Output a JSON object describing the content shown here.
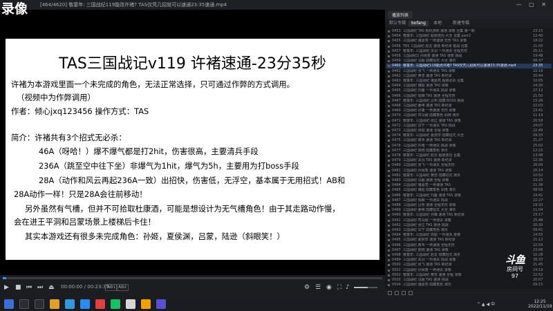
{
  "overlay": {
    "recording_label": "录像"
  },
  "window": {
    "count": "[464/4620]",
    "title": "[464/4620] 敬童年: 三国战纪119能改许褚? TAS仅凭几招就可以速通23:35速通.mp4",
    "controls": "— ▢ ✕"
  },
  "slide": {
    "title": "TAS三国战记v119 许褚速通-23分35秒",
    "lines": [
      "许褚为本游戏里面一个未完成的角色，无法正常选择，只可通过作弊的方式调用。",
      "（视频中为作弊调用）",
      "作者：倾心jxq123456      操作方式：TAS",
      "简介：许褚共有3个招式无必杀：",
      "46A（呀哈！）爆不爆气都是打2hit，伤害很高，主要清兵手段",
      "236A（跳至空中往下坐）非爆气为1hit，爆气为5h，主要用为打boss手段",
      "28A（动作和风云再起236A一致）出招快，伤害低，无浮空，基本属于无用招式！AB和",
      "28A动作一样！只是28A会往前移动！",
      "另外虽然有气槽，但并不可拾取杜康酒，可能是想设计为无气槽角色！由于其走路动作慢，",
      "会在进王平洞和吕蒙场景上楼梯后卡住！",
      "其实本游戏还有很多未完成角色：孙姬，夏侯渊，吕蒙，陆逊（斜眼笑！）"
    ]
  },
  "player": {
    "progress": 0.01,
    "time": "00:00:00 / 00:23:35",
    "tag1": "AB1",
    "tag2": "AB2",
    "volume": 0.6
  },
  "playlist": {
    "title": "播放列表",
    "tabs": [
      "默认专辑",
      "bofang",
      "本地",
      "新建专辑"
    ],
    "active_index": 7,
    "items": [
      {
        "num": "0453",
        "name": "三国战纪 TAS 街机游戏 速通 录像 合集 第一期",
        "dur": "23:15"
      },
      {
        "num": "0454",
        "name": "敬童年: 三国战纪 超级连招 大全 合集 part2",
        "dur": "12:40"
      },
      {
        "num": "0455",
        "name": "三国战纪 诸葛亮 一命速通 无伤 TAS 录像",
        "dur": "18:22"
      },
      {
        "num": "0456",
        "name": "TAS 三国战纪 赵云 速通 新纪录 挑战 合集",
        "dur": "21:05"
      },
      {
        "num": "0457",
        "name": "敬童年: 三国战纪 关羽 一币通关 全程无伤",
        "dur": "25:11"
      },
      {
        "num": "0458",
        "name": "三国战纪2 孙尚香 速通 TAS 录像 挑战",
        "dur": "19:48"
      },
      {
        "num": "0459",
        "name": "三国战纪 马超 隐藏招式 大全 演示",
        "dur": "08:37"
      },
      {
        "num": "0460",
        "name": "敬童年: 三国战纪119能改许褚? TAS仅凭几招就可以速通23:35速通.mp4",
        "dur": "23:35"
      },
      {
        "num": "0461",
        "name": "三国战纪 张飞 一命通关 TAS 录像",
        "dur": "22:18"
      },
      {
        "num": "0462",
        "name": "三国战纪 黄忠 速通 TAS 新纪录",
        "dur": "20:44"
      },
      {
        "num": "0463",
        "name": "敬童年: 三国战纪 诸葛亮 超级必杀 合集",
        "dur": "10:05"
      },
      {
        "num": "0464",
        "name": "三国战纪 魏延 速通 TAS 录像",
        "dur": "24:30"
      },
      {
        "num": "0465",
        "name": "三国战纪 刘备 一币通关 挑战 录像",
        "dur": "27:12"
      },
      {
        "num": "0466",
        "name": "三国战纪 貂蝉 TAS 速通 全程无伤",
        "dur": "21:50"
      },
      {
        "num": "0467",
        "name": "敬童年: 三国战纪 吕布 隐藏 BOSS 挑战",
        "dur": "15:26"
      },
      {
        "num": "0468",
        "name": "三国战纪 姜维 速通 TAS 新纪录",
        "dur": "22:03"
      },
      {
        "num": "0469",
        "name": "三国战纪 孙策 一命速通 无伤 录像",
        "dur": "23:41"
      },
      {
        "num": "0470",
        "name": "三国战纪 司马懿 隐藏角色 调用 演示",
        "dur": "11:19"
      },
      {
        "num": "0471",
        "name": "敬童年: 三国战纪 张辽 速通 TAS 录像",
        "dur": "20:58"
      },
      {
        "num": "0472",
        "name": "三国战纪 甘宁 一币通关 TAS 挑战",
        "dur": "24:07"
      },
      {
        "num": "0473",
        "name": "三国战纪 周瑜 速通 全程 录像",
        "dur": "22:49"
      },
      {
        "num": "0474",
        "name": "敬童年: 三国战纪 夏侯惇 隐藏招式 大全",
        "dur": "09:33"
      },
      {
        "num": "0475",
        "name": "三国战纪 典韦 速通 TAS 新纪录",
        "dur": "21:27"
      },
      {
        "num": "0476",
        "name": "三国战纪 许褚 一命通关 挑战 录像",
        "dur": "25:02"
      },
      {
        "num": "0477",
        "name": "三国战纪 庞统 隐藏角色 演示",
        "dur": "12:15"
      },
      {
        "num": "0478",
        "name": "敬童年: 三国战纪 赵云 超级连招 合集",
        "dur": "13:48"
      },
      {
        "num": "0479",
        "name": "三国战纪 关羽 TAS 速通 新纪录",
        "dur": "22:36"
      },
      {
        "num": "0480",
        "name": "三国战纪 张飞 一币通关 全程无伤",
        "dur": "26:09"
      },
      {
        "num": "0481",
        "name": "三国战纪 孙尚香 速通 TAS 录像",
        "dur": "20:14"
      },
      {
        "num": "0482",
        "name": "敬童年: 三国战纪 黄忠 隐藏招式 演示",
        "dur": "10:52"
      },
      {
        "num": "0483",
        "name": "三国战纪 马超 速通 全程 录像",
        "dur": "23:25"
      },
      {
        "num": "0484",
        "name": "三国战纪 诸葛亮 一命速通 TAS",
        "dur": "21:38"
      },
      {
        "num": "0485",
        "name": "三国战纪 魏延 隐藏角色 调用 演示",
        "dur": "08:56"
      },
      {
        "num": "0486",
        "name": "敬童年: 三国战纪 刘备 速通 TAS 录像",
        "dur": "24:41"
      },
      {
        "num": "0487",
        "name": "三国战纪 貂蝉 一币通关 挑战",
        "dur": "22:27"
      },
      {
        "num": "0488",
        "name": "三国战纪 吕布 速通 全程无伤 录像",
        "dur": "19:33"
      },
      {
        "num": "0489",
        "name": "三国战纪 姜维 隐藏招式 大全 演示",
        "dur": "11:04"
      },
      {
        "num": "0490",
        "name": "敬童年: 三国战纪 孙策 速通 TAS 新纪录",
        "dur": "23:17"
      },
      {
        "num": "0491",
        "name": "三国战纪 司马懿 一命通关 录像",
        "dur": "25:48"
      },
      {
        "num": "0492",
        "name": "三国战纪 张辽 TAS 速通 挑战",
        "dur": "20:30"
      },
      {
        "num": "0493",
        "name": "三国战纪 甘宁 隐藏角色 演示",
        "dur": "09:41"
      },
      {
        "num": "0494",
        "name": "敬童年: 三国战纪 周瑜 一币通关 录像",
        "dur": "24:55"
      },
      {
        "num": "0495",
        "name": "三国战纪 夏侯惇 速通 TAS 新纪录",
        "dur": "21:12"
      },
      {
        "num": "0496",
        "name": "三国战纪 典韦 一命速通 全程无伤",
        "dur": "22:59"
      },
      {
        "num": "0497",
        "name": "三国战纪 庞统 速通 TAS 录像",
        "dur": "23:06"
      },
      {
        "num": "0498",
        "name": "敬童年: 三国战纪 赵云 隐藏招式 演示",
        "dur": "10:28"
      },
      {
        "num": "0499",
        "name": "三国战纪 关羽 一币通关 挑战 录像",
        "dur": "26:33"
      },
      {
        "num": "0500",
        "name": "三国战纪 张飞 速通 TAS 新纪录",
        "dur": "21:45"
      },
      {
        "num": "0501",
        "name": "三国战纪 孙尚香 一命通关 录像",
        "dur": "24:19"
      },
      {
        "num": "0502",
        "name": "敬童年: 三国战纪 黄忠 速通 全程 录像",
        "dur": "22:52"
      },
      {
        "num": "0503",
        "name": "三国战纪 马超 TAS 速通 挑战",
        "dur": "20:07"
      },
      {
        "num": "0504",
        "name": "三国战纪 诸葛亮 隐藏角色 演示",
        "dur": "09:15"
      }
    ]
  },
  "watermark": {
    "logo": "斗鱼",
    "room_label": "房间号",
    "room_number": "97"
  },
  "taskbar": {
    "time": "12:25",
    "date": "2022/11/19",
    "tray_lang": "中",
    "tray_text": "^ ▲ ◀ 中"
  },
  "colors": {
    "accent": "#3c8cff",
    "active_row": "#263a5a"
  }
}
